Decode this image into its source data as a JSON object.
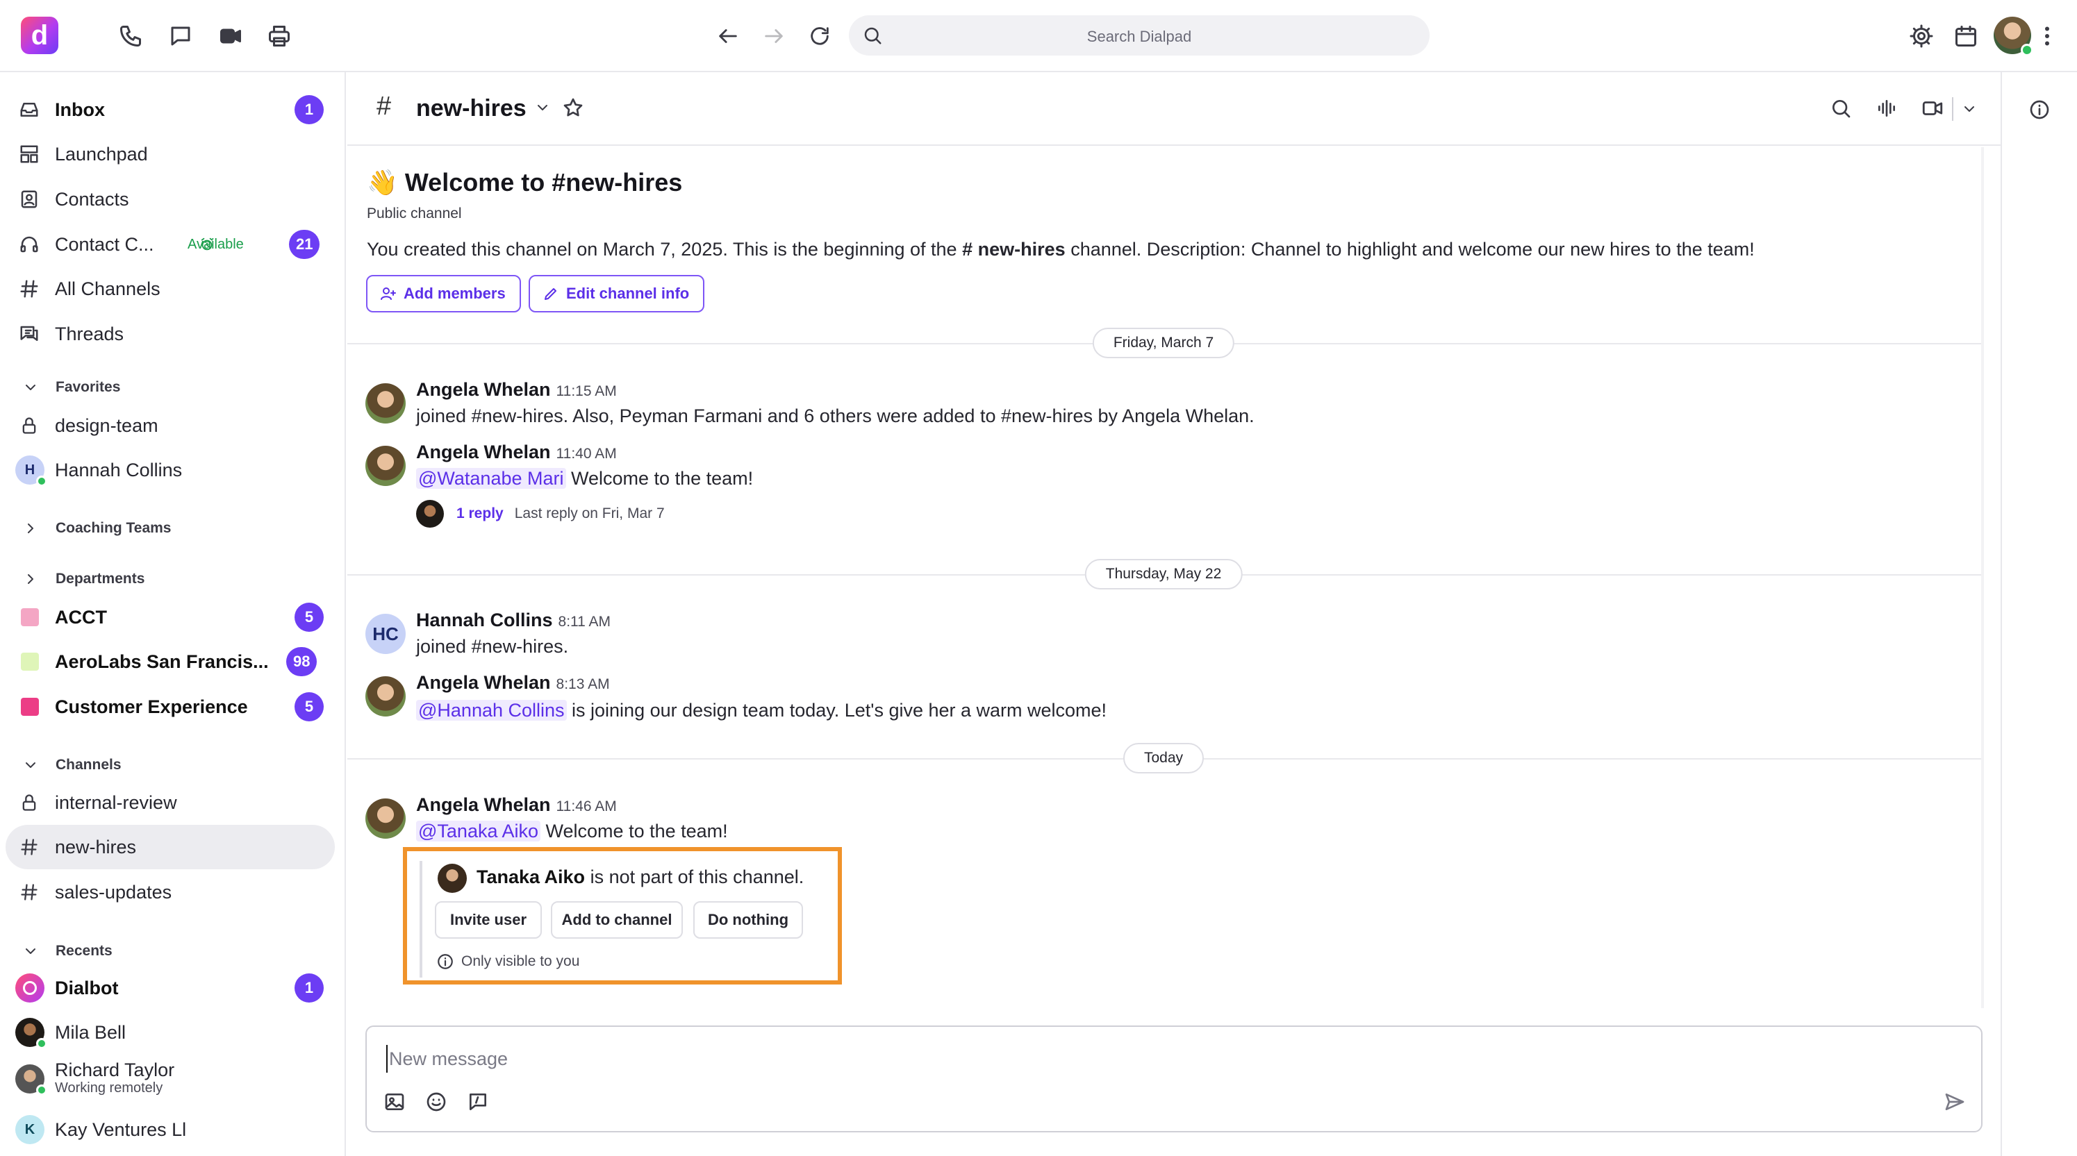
{
  "app": {
    "brand_icon": "dialpad-logo",
    "accent_color": "#6c3df4",
    "highlight_color": "#f0932b"
  },
  "topbar": {
    "left_icons": [
      "phone-icon",
      "chat-icon",
      "video-icon",
      "print-icon"
    ],
    "search_placeholder": "Search Dialpad",
    "right_icons": [
      "gear-icon",
      "calendar-icon",
      "avatar",
      "more-vertical-icon"
    ]
  },
  "sidebar": {
    "nav": [
      {
        "label": "Inbox",
        "icon": "inbox-icon",
        "badge": "1",
        "bold": true
      },
      {
        "label": "Launchpad",
        "icon": "launchpad-icon"
      },
      {
        "label": "Contacts",
        "icon": "contacts-icon"
      },
      {
        "label": "Contact C...",
        "icon": "headset-icon",
        "status": "Available",
        "badge": "21"
      },
      {
        "label": "All Channels",
        "icon": "hash-icon"
      },
      {
        "label": "Threads",
        "icon": "threads-icon"
      }
    ],
    "favorites": {
      "title": "Favorites",
      "items": [
        {
          "label": "design-team",
          "icon": "lock-icon"
        },
        {
          "label": "Hannah Collins",
          "initial": "H"
        }
      ]
    },
    "coaching_title": "Coaching Teams",
    "departments": {
      "title": "Departments",
      "items": [
        {
          "label": "ACCT",
          "color": "#f4a6c4",
          "badge": "5"
        },
        {
          "label": "AeroLabs San Francis...",
          "color": "#dff5b8",
          "badge": "98"
        },
        {
          "label": "Customer Experience",
          "color": "#ec3d86",
          "badge": "5"
        }
      ]
    },
    "channels": {
      "title": "Channels",
      "items": [
        {
          "label": "internal-review",
          "icon": "lock-icon"
        },
        {
          "label": "new-hires",
          "icon": "hash-icon",
          "active": true
        },
        {
          "label": "sales-updates",
          "icon": "hash-icon"
        }
      ]
    },
    "recents": {
      "title": "Recents",
      "items": [
        {
          "label": "Dialbot",
          "badge": "1",
          "bold": true
        },
        {
          "label": "Mila Bell"
        },
        {
          "label": "Richard Taylor",
          "sub": "Working remotely"
        },
        {
          "label": "Kay Ventures Ll",
          "initial": "K"
        }
      ]
    }
  },
  "channel": {
    "hash": "#",
    "name": "new-hires",
    "welcome_emoji": "👋",
    "welcome_prefix": "Welcome to",
    "public_label": "Public channel",
    "intro_before": "You created this channel on March 7, 2025. This is the beginning of the",
    "intro_after": "channel. Description: Channel to highlight and welcome our new hires to the team!",
    "add_members": "Add members",
    "edit_info": "Edit channel info"
  },
  "messages": {
    "date1": "Friday, March 7",
    "date2": "Thursday, May 22",
    "date3": "Today",
    "m1": {
      "author": "Angela Whelan",
      "time": "11:15 AM",
      "text": "joined #new-hires. Also, Peyman Farmani and 6 others were added to #new-hires by Angela Whelan."
    },
    "m2": {
      "author": "Angela Whelan",
      "time": "11:40 AM",
      "mention": "@Watanabe Mari",
      "text": "Welcome to the team!",
      "reply_count": "1 reply",
      "reply_meta": "Last reply on Fri, Mar 7"
    },
    "m3": {
      "author": "Hannah Collins",
      "initials": "HC",
      "time": "8:11 AM",
      "text": "joined #new-hires."
    },
    "m4": {
      "author": "Angela Whelan",
      "time": "8:13 AM",
      "mention": "@Hannah Collins",
      "text": "is joining our design team today. Let's give her a warm welcome!"
    },
    "m5": {
      "author": "Angela Whelan",
      "time": "11:46 AM",
      "mention": "@Tanaka Aiko",
      "text": "Welcome to the team!"
    }
  },
  "ephemeral": {
    "user": "Tanaka Aiko",
    "text": "is not part of this channel.",
    "buttons": [
      "Invite user",
      "Add to channel",
      "Do nothing"
    ],
    "note": "Only visible to you"
  },
  "composer": {
    "placeholder": "New message"
  }
}
